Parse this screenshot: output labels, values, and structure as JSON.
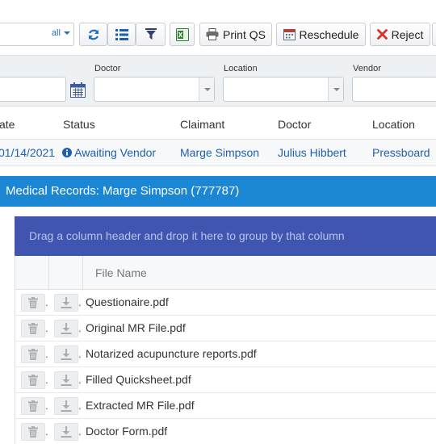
{
  "toolbar": {
    "search_scope": "all",
    "refresh_icon": "refresh-icon",
    "columns_icon": "list-icon",
    "filter_icon": "filter-icon",
    "excel_icon": "excel-icon",
    "print_label": "Print QS",
    "reschedule_label": "Reschedule",
    "reject_label": "Reject"
  },
  "filters": {
    "doctor_label": "Doctor",
    "location_label": "Location",
    "vendor_label": "Vendor"
  },
  "results": {
    "headers": {
      "date": "ate",
      "status": "Status",
      "claimant": "Claimant",
      "doctor": "Doctor",
      "location": "Location"
    },
    "row": {
      "date": "01/14/2021",
      "status": "Awaiting Vendor",
      "claimant": "Marge Simpson",
      "doctor": "Julius Hibbert",
      "location": "Pressboard"
    }
  },
  "panel": {
    "title": "Medical Records: Marge Simpson (777787)",
    "group_hint": "Drag a column header and drop it here to group by that column",
    "file_column": "File Name",
    "files": [
      "Questionaire.pdf",
      "Original MR File.pdf",
      "Notarized acupuncture reports.pdf",
      "Filled Quicksheet.pdf",
      "Extracted MR File.pdf",
      "Doctor Form.pdf"
    ]
  },
  "colors": {
    "accent": "#1b86d3",
    "group_bar": "#3f55b0",
    "link": "#1f5fae"
  }
}
